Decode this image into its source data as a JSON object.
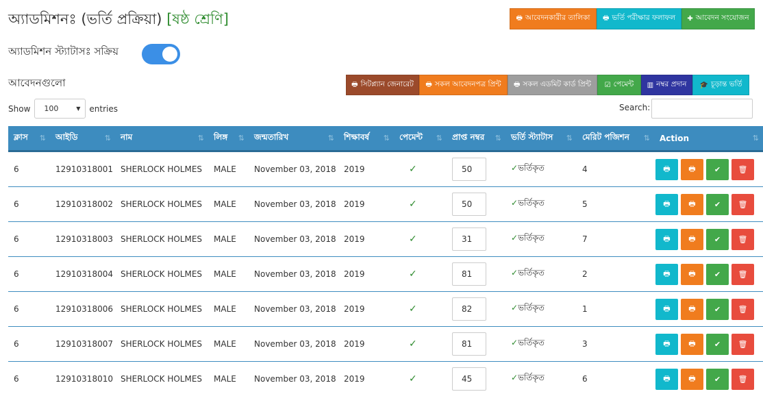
{
  "header": {
    "title": "অ্যাডমিশনঃ (ভর্তি প্রক্রিয়া)",
    "class_label": "[ষষ্ঠ শ্রেণি]"
  },
  "top_actions": [
    {
      "label": "আবেদনকারীর তালিকা",
      "icon": "printer-icon",
      "color": "#f07c1e"
    },
    {
      "label": "ভর্তি পরীক্ষার ফলাফল",
      "icon": "printer-icon",
      "color": "#11b8cc"
    },
    {
      "label": "আবেদন সংযোজন",
      "icon": "plus-icon",
      "color": "#43a84a"
    }
  ],
  "status": {
    "label": "অ্যাডমিশন স্ট্যাটাসঃ সক্রিয়",
    "toggle_on": true,
    "toggle_color": "#3b8fe6"
  },
  "section_title": "আবেদনগুলো",
  "mid_actions": [
    {
      "label": "সিটপ্ল্যান জেনারেট",
      "icon": "printer-icon",
      "color": "#9b4a2b"
    },
    {
      "label": "সকল আবেদনপত্র প্রিন্ট",
      "icon": "printer-icon",
      "color": "#f07c1e"
    },
    {
      "label": "সকল এডমিট কার্ড প্রিন্ট",
      "icon": "printer-icon",
      "color": "#9e9e9e"
    },
    {
      "label": "পেমেন্ট",
      "icon": "check-square-icon",
      "color": "#43a84a"
    },
    {
      "label": "নম্বর প্রদান",
      "icon": "bar-chart-icon",
      "color": "#2f35a0"
    },
    {
      "label": "চূড়ান্ত ভর্তি",
      "icon": "graduation-cap-icon",
      "color": "#11b8cc"
    }
  ],
  "table_controls": {
    "show_label": "Show",
    "entries_value": "100",
    "entries_label": "entries",
    "search_label": "Search:"
  },
  "columns": [
    "ক্লাস",
    "আইডি",
    "নাম",
    "লিঙ্গ",
    "জন্মতারিখ",
    "শিক্ষাবর্ষ",
    "পেমেন্ট",
    "প্রাপ্ত নম্বর",
    "ভর্তি স্ট্যাটাস",
    "মেরিট পজিশন",
    "Action"
  ],
  "rows": [
    {
      "class": "6",
      "id": "12910318001",
      "name": "SHERLOCK HOLMES",
      "gender": "MALE",
      "dob": "November 03, 2018",
      "year": "2019",
      "payment": "✓",
      "marks": "50",
      "status": "ভর্তিকৃত",
      "merit": "4"
    },
    {
      "class": "6",
      "id": "12910318002",
      "name": "SHERLOCK HOLMES",
      "gender": "MALE",
      "dob": "November 03, 2018",
      "year": "2019",
      "payment": "✓",
      "marks": "50",
      "status": "ভর্তিকৃত",
      "merit": "5"
    },
    {
      "class": "6",
      "id": "12910318003",
      "name": "SHERLOCK HOLMES",
      "gender": "MALE",
      "dob": "November 03, 2018",
      "year": "2019",
      "payment": "✓",
      "marks": "31",
      "status": "ভর্তিকৃত",
      "merit": "7"
    },
    {
      "class": "6",
      "id": "12910318004",
      "name": "SHERLOCK HOLMES",
      "gender": "MALE",
      "dob": "November 03, 2018",
      "year": "2019",
      "payment": "✓",
      "marks": "81",
      "status": "ভর্তিকৃত",
      "merit": "2"
    },
    {
      "class": "6",
      "id": "12910318006",
      "name": "SHERLOCK HOLMES",
      "gender": "MALE",
      "dob": "November 03, 2018",
      "year": "2019",
      "payment": "✓",
      "marks": "82",
      "status": "ভর্তিকৃত",
      "merit": "1"
    },
    {
      "class": "6",
      "id": "12910318007",
      "name": "SHERLOCK HOLMES",
      "gender": "MALE",
      "dob": "November 03, 2018",
      "year": "2019",
      "payment": "✓",
      "marks": "81",
      "status": "ভর্তিকৃত",
      "merit": "3"
    },
    {
      "class": "6",
      "id": "12910318010",
      "name": "SHERLOCK HOLMES",
      "gender": "MALE",
      "dob": "November 03, 2018",
      "year": "2019",
      "payment": "✓",
      "marks": "45",
      "status": "ভর্তিকৃত",
      "merit": "6"
    }
  ],
  "row_actions": [
    {
      "icon": "printer-icon",
      "color": "#11b8cc"
    },
    {
      "icon": "printer-icon",
      "color": "#f07c1e"
    },
    {
      "icon": "check-icon",
      "color": "#43a84a"
    },
    {
      "icon": "trash-icon",
      "color": "#e84c3d"
    }
  ],
  "colors": {
    "table_header": "#3d8cbf",
    "check_green": "#2e8b2e"
  }
}
